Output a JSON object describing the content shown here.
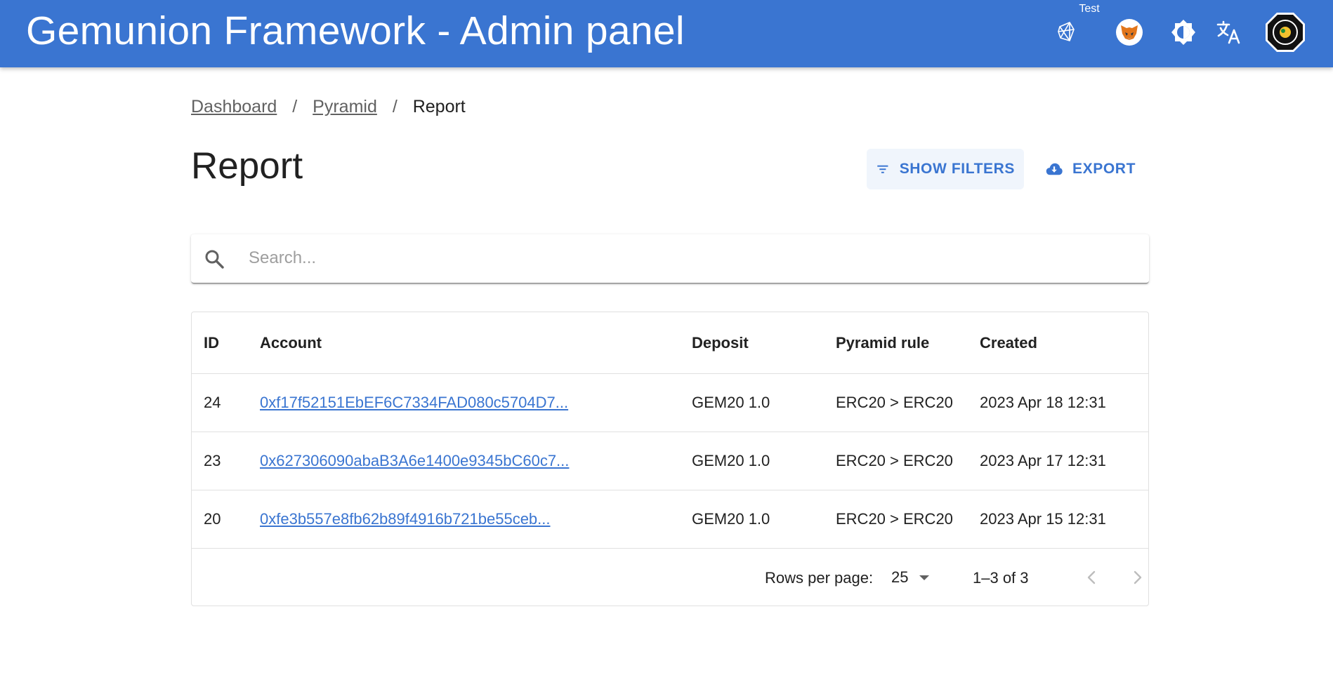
{
  "app": {
    "title": "Gemunion Framework - Admin panel",
    "network_label": "Test",
    "icons": [
      "network-icon",
      "metamask-icon",
      "theme-toggle-icon",
      "translate-icon",
      "avatar"
    ]
  },
  "breadcrumb": {
    "items": [
      "Dashboard",
      "Pyramid"
    ],
    "current": "Report",
    "separator": "/"
  },
  "page": {
    "title": "Report",
    "filters_label": "SHOW FILTERS",
    "export_label": "EXPORT"
  },
  "search": {
    "placeholder": "Search...",
    "value": ""
  },
  "table": {
    "columns": [
      "ID",
      "Account",
      "Deposit",
      "Pyramid rule",
      "Created"
    ],
    "rows": [
      {
        "id": "24",
        "account": "0xf17f52151EbEF6C7334FAD080c5704D7...",
        "deposit": "GEM20 1.0",
        "rule": "ERC20 > ERC20",
        "created": "2023 Apr 18 12:31"
      },
      {
        "id": "23",
        "account": "0x627306090abaB3A6e1400e9345bC60c7...",
        "deposit": "GEM20 1.0",
        "rule": "ERC20 > ERC20",
        "created": "2023 Apr 17 12:31"
      },
      {
        "id": "20",
        "account": "0xfe3b557e8fb62b89f4916b721be55ceb...",
        "deposit": "GEM20 1.0",
        "rule": "ERC20 > ERC20",
        "created": "2023 Apr 15 12:31"
      }
    ]
  },
  "pagination": {
    "rows_per_page_label": "Rows per page:",
    "rows_per_page": "25",
    "range": "1–3 of 3"
  },
  "colors": {
    "primary": "#3a75d1",
    "link": "#3a75d1",
    "filters_bg": "#f0f5fc"
  }
}
